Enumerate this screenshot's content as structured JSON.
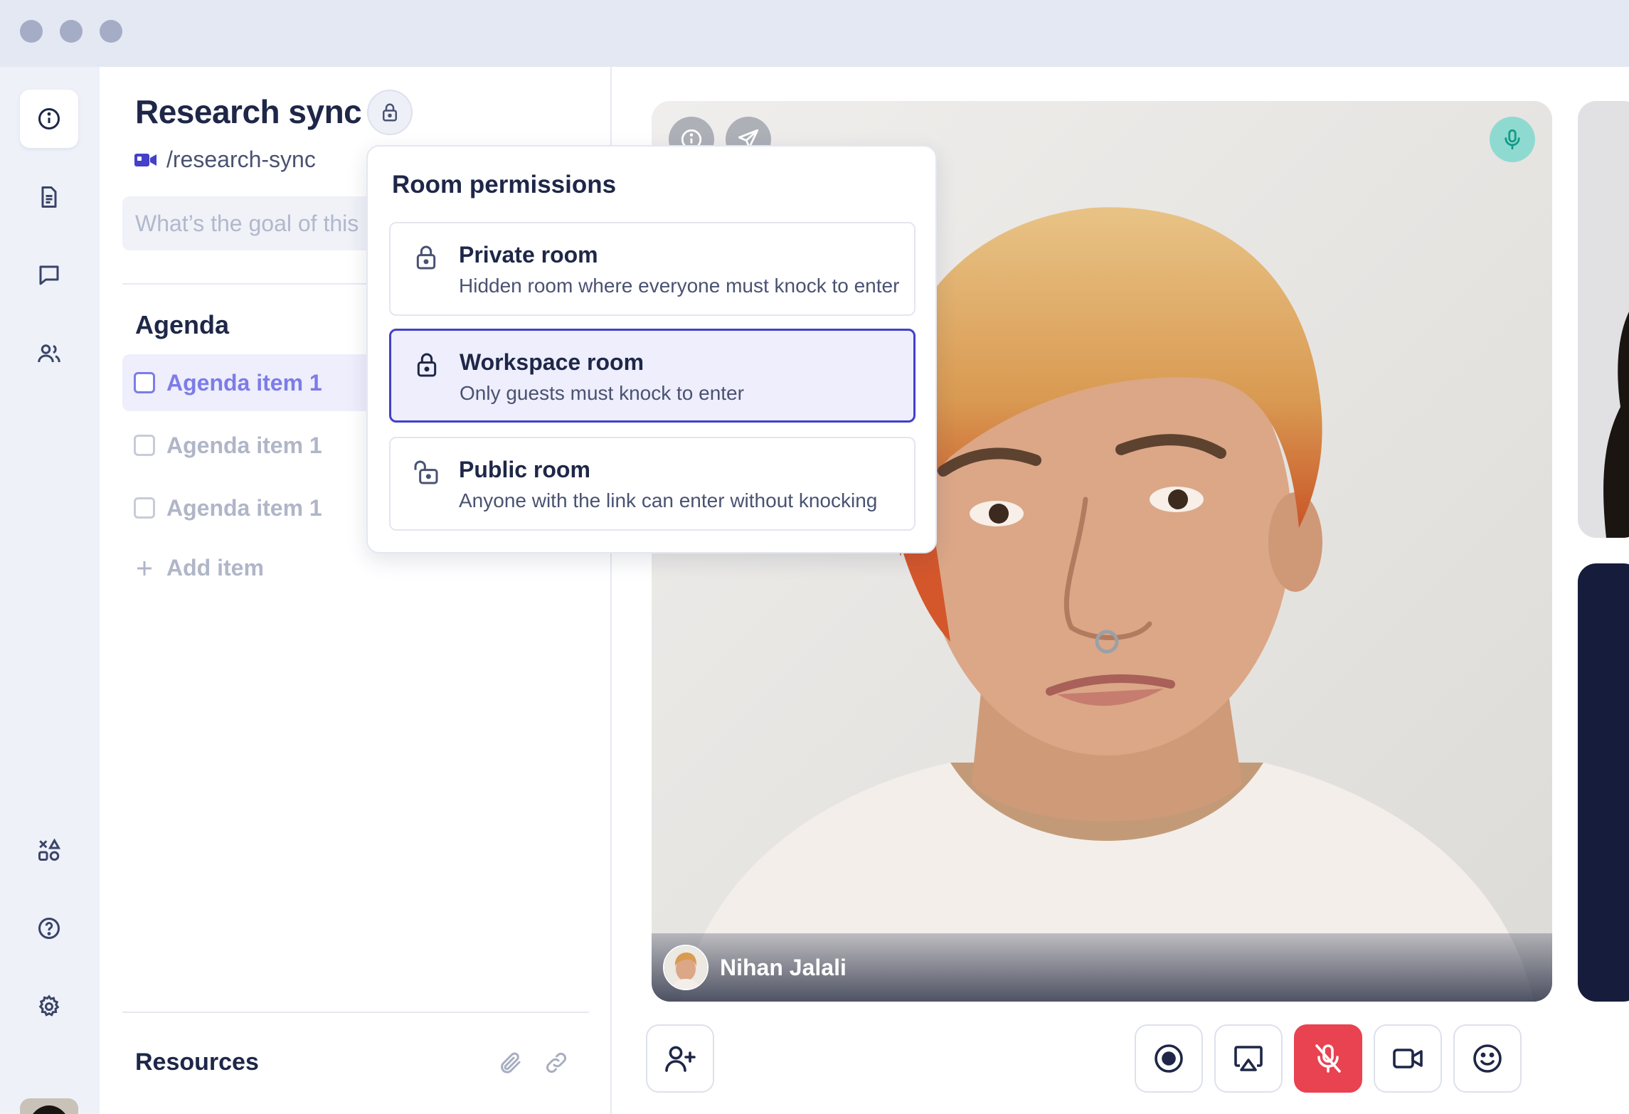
{
  "window": {
    "title": ""
  },
  "rail": {
    "items": [
      {
        "name": "info",
        "icon": "info-icon"
      },
      {
        "name": "notes",
        "icon": "document-icon"
      },
      {
        "name": "chat",
        "icon": "chat-icon"
      },
      {
        "name": "people",
        "icon": "users-icon"
      },
      {
        "name": "apps",
        "icon": "shapes-icon"
      },
      {
        "name": "help",
        "icon": "help-icon"
      },
      {
        "name": "settings",
        "icon": "gear-icon"
      }
    ]
  },
  "room": {
    "title": "Research sync",
    "slug": "/research-sync",
    "goal_placeholder": "What’s the goal of this meeting?",
    "goal_value": ""
  },
  "agenda": {
    "title": "Agenda",
    "items": [
      {
        "label": "Agenda item 1",
        "checked": false,
        "active": true
      },
      {
        "label": "Agenda item 1",
        "checked": false,
        "active": false
      },
      {
        "label": "Agenda item 1",
        "checked": false,
        "active": false
      }
    ],
    "add_label": "Add item"
  },
  "resources": {
    "title": "Resources"
  },
  "permissions": {
    "title": "Room permissions",
    "selected": "workspace",
    "options": [
      {
        "id": "private",
        "icon": "lock-icon",
        "name": "Private room",
        "desc": "Hidden room where everyone must knock to enter"
      },
      {
        "id": "workspace",
        "icon": "lock-icon",
        "name": "Workspace room",
        "desc": "Only guests must knock to enter"
      },
      {
        "id": "public",
        "icon": "unlock-icon",
        "name": "Public room",
        "desc": "Anyone with the link can enter without knocking"
      }
    ]
  },
  "video": {
    "participant": "Nihan Jalali",
    "mic_status": "speaking"
  },
  "controls": {
    "buttons": [
      "invite",
      "record",
      "share-screen",
      "mute-mic",
      "camera",
      "reactions"
    ],
    "mic_muted": true
  },
  "colors": {
    "accent": "#4340c9",
    "accent_soft": "#eeeefc",
    "danger": "#e94250",
    "mic_active": "#8fdad0",
    "text": "#1e2748"
  }
}
